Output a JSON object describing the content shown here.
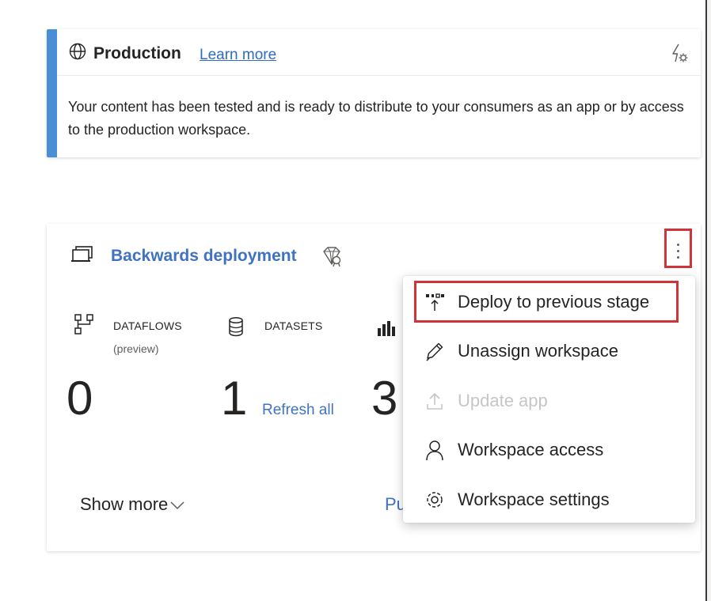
{
  "stage": {
    "title": "Production",
    "learn_more": "Learn more",
    "description": "Your content has been tested and is ready to distribute to your consumers as an app or by access to the production workspace.",
    "accent_color": "#4a8fd6"
  },
  "workspace": {
    "name": "Backwards deployment",
    "stats": [
      {
        "label": "DATAFLOWS",
        "sublabel": "(preview)",
        "count": "0"
      },
      {
        "label": "DATASETS",
        "sublabel": "",
        "count": "1",
        "action": "Refresh all"
      },
      {
        "label": "",
        "sublabel": "",
        "count": "3"
      }
    ],
    "show_more": "Show more",
    "partial_link": "Pu"
  },
  "menu": {
    "items": [
      {
        "label": "Deploy to previous stage",
        "icon": "deploy-back-icon",
        "disabled": false,
        "highlighted": true
      },
      {
        "label": "Unassign workspace",
        "icon": "pencil-icon",
        "disabled": false
      },
      {
        "label": "Update app",
        "icon": "upload-icon",
        "disabled": true
      },
      {
        "label": "Workspace access",
        "icon": "person-icon",
        "disabled": false
      },
      {
        "label": "Workspace settings",
        "icon": "gear-icon",
        "disabled": false
      }
    ]
  },
  "colors": {
    "link": "#3f72c3",
    "highlight": "#d13438",
    "disabled_text": "#c8c6c4"
  }
}
